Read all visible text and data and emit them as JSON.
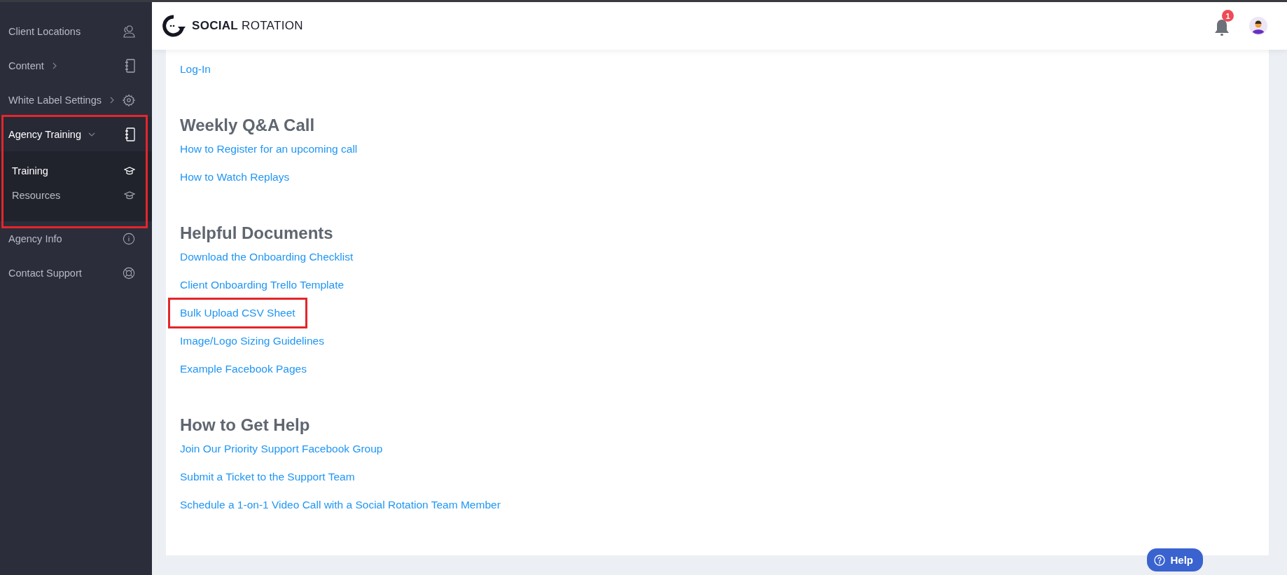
{
  "sidebar": {
    "items": [
      {
        "label": "Client Locations",
        "kind": "plain",
        "selected": false
      },
      {
        "label": "Content",
        "kind": "collapsible",
        "expanded": false,
        "selected": false
      },
      {
        "label": "White Label Settings",
        "kind": "collapsible",
        "expanded": false,
        "selected": false
      },
      {
        "label": "Agency Training",
        "kind": "collapsible",
        "expanded": true,
        "selected": true,
        "children": [
          {
            "label": "Training",
            "selected": true
          },
          {
            "label": "Resources",
            "selected": false
          }
        ]
      },
      {
        "label": "Agency Info",
        "kind": "plain",
        "selected": false
      },
      {
        "label": "Contact Support",
        "kind": "plain",
        "selected": false
      }
    ]
  },
  "header": {
    "brand_bold": "SOCIAL",
    "brand_light": "ROTATION",
    "notification_count": "1"
  },
  "sections": [
    {
      "links": [
        {
          "label": "Log-In",
          "highlighted": false
        }
      ]
    },
    {
      "heading": "Weekly Q&A Call",
      "links": [
        {
          "label": "How to Register for an upcoming call",
          "highlighted": false
        },
        {
          "label": "How to Watch Replays",
          "highlighted": false
        }
      ]
    },
    {
      "heading": "Helpful Documents",
      "links": [
        {
          "label": "Download the Onboarding Checklist",
          "highlighted": false
        },
        {
          "label": "Client Onboarding Trello Template",
          "highlighted": false
        },
        {
          "label": "Bulk Upload CSV Sheet",
          "highlighted": true
        },
        {
          "label": "Image/Logo Sizing Guidelines",
          "highlighted": false
        },
        {
          "label": "Example Facebook Pages",
          "highlighted": false
        }
      ]
    },
    {
      "heading": "How to Get Help",
      "links": [
        {
          "label": "Join Our Priority Support Facebook Group",
          "highlighted": false
        },
        {
          "label": "Submit a Ticket to the Support Team",
          "highlighted": false
        },
        {
          "label": "Schedule a 1-on-1 Video Call with a Social Rotation Team Member",
          "highlighted": false
        }
      ]
    }
  ],
  "help_button": {
    "label": "Help"
  }
}
